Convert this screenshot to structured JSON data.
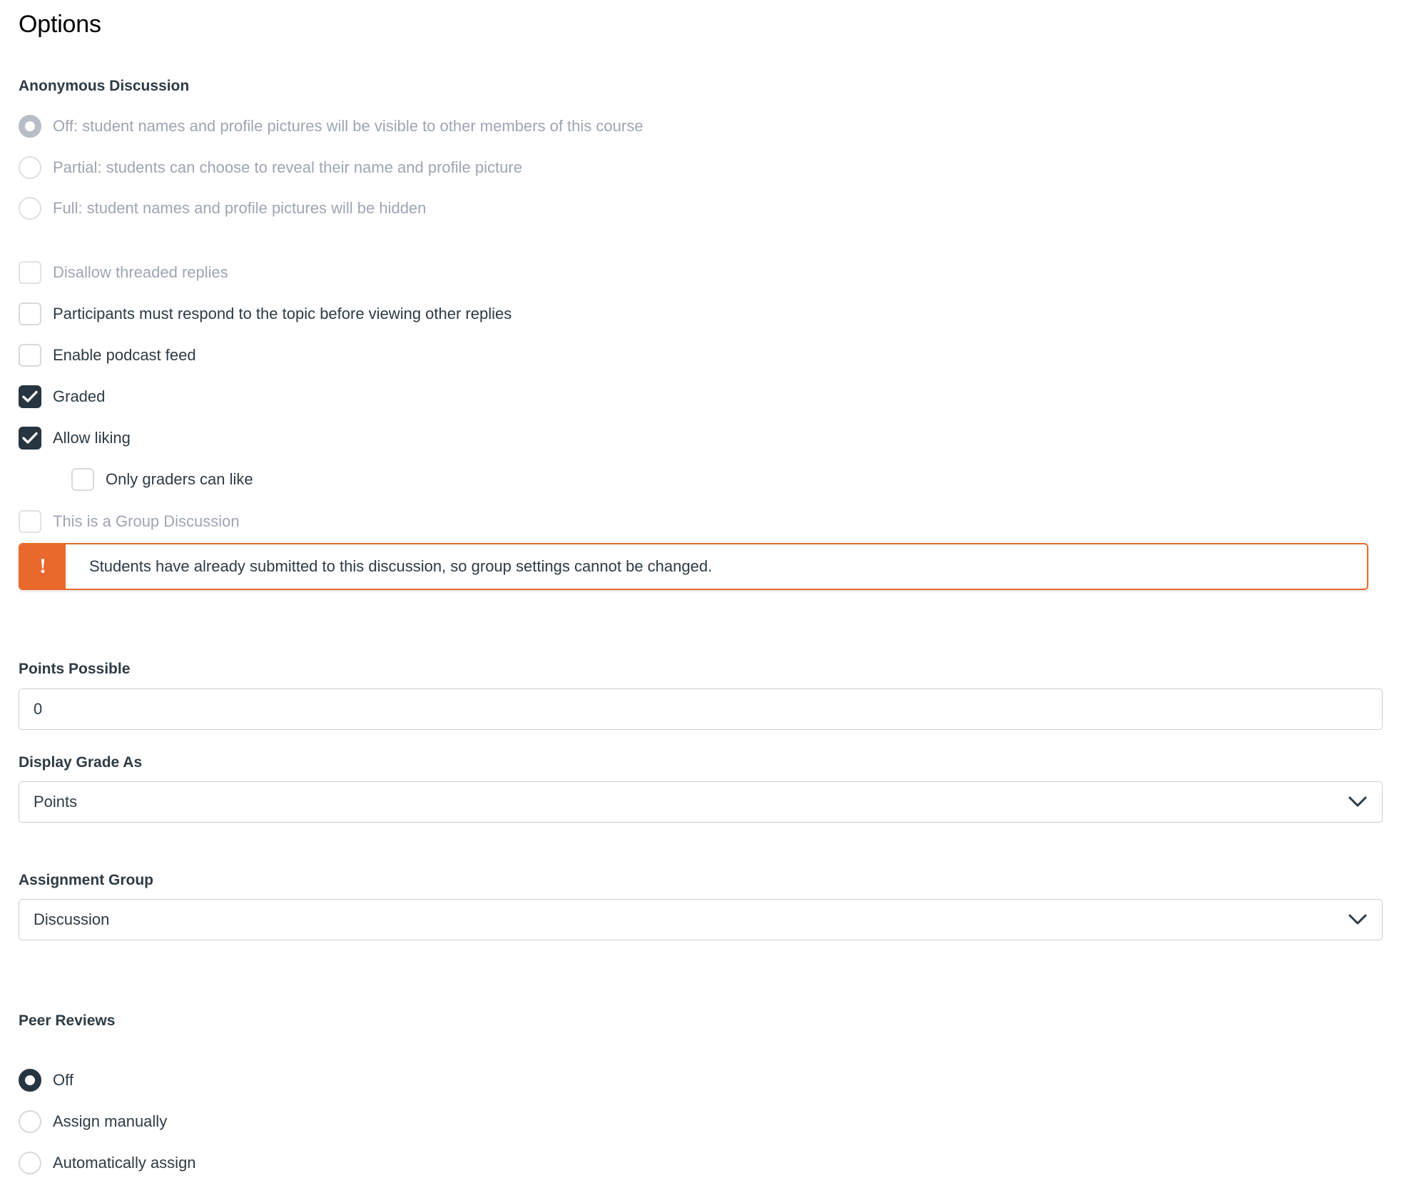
{
  "page": {
    "title": "Options"
  },
  "anonymous": {
    "heading": "Anonymous Discussion",
    "options": [
      {
        "label": "Off: student names and profile pictures will be visible to other members of this course",
        "selected": true,
        "disabled": true
      },
      {
        "label": "Partial: students can choose to reveal their name and profile picture",
        "selected": false,
        "disabled": true
      },
      {
        "label": "Full: student names and profile pictures will be hidden",
        "selected": false,
        "disabled": true
      }
    ]
  },
  "checkboxes": [
    {
      "label": "Disallow threaded replies",
      "checked": false,
      "disabled": true
    },
    {
      "label": "Participants must respond to the topic before viewing other replies",
      "checked": false,
      "disabled": false
    },
    {
      "label": "Enable podcast feed",
      "checked": false,
      "disabled": false
    },
    {
      "label": "Graded",
      "checked": true,
      "disabled": false
    },
    {
      "label": "Allow liking",
      "checked": true,
      "disabled": false
    },
    {
      "label": "Only graders can like",
      "checked": false,
      "disabled": false,
      "indented": true
    },
    {
      "label": "This is a Group Discussion",
      "checked": false,
      "disabled": true
    }
  ],
  "alert": {
    "icon": "exclamation-icon",
    "icon_glyph": "!",
    "message": "Students have already submitted to this discussion, so group settings cannot be changed.",
    "accent_color": "#E8692B"
  },
  "points_possible": {
    "label": "Points Possible",
    "value": "0",
    "placeholder": ""
  },
  "display_grade_as": {
    "label": "Display Grade As",
    "value": "Points",
    "icon": "chevron-down-icon"
  },
  "assignment_group": {
    "label": "Assignment Group",
    "value": "Discussion",
    "icon": "chevron-down-icon"
  },
  "peer_reviews": {
    "heading": "Peer Reviews",
    "options": [
      {
        "label": "Off",
        "selected": true
      },
      {
        "label": "Assign manually",
        "selected": false
      },
      {
        "label": "Automatically assign",
        "selected": false
      }
    ]
  },
  "colors": {
    "text": "#2D3B45",
    "muted_text": "#9EA6B3",
    "control_navy": "#273540",
    "alert_orange": "#E8692B",
    "border": "#C7CDD1"
  }
}
